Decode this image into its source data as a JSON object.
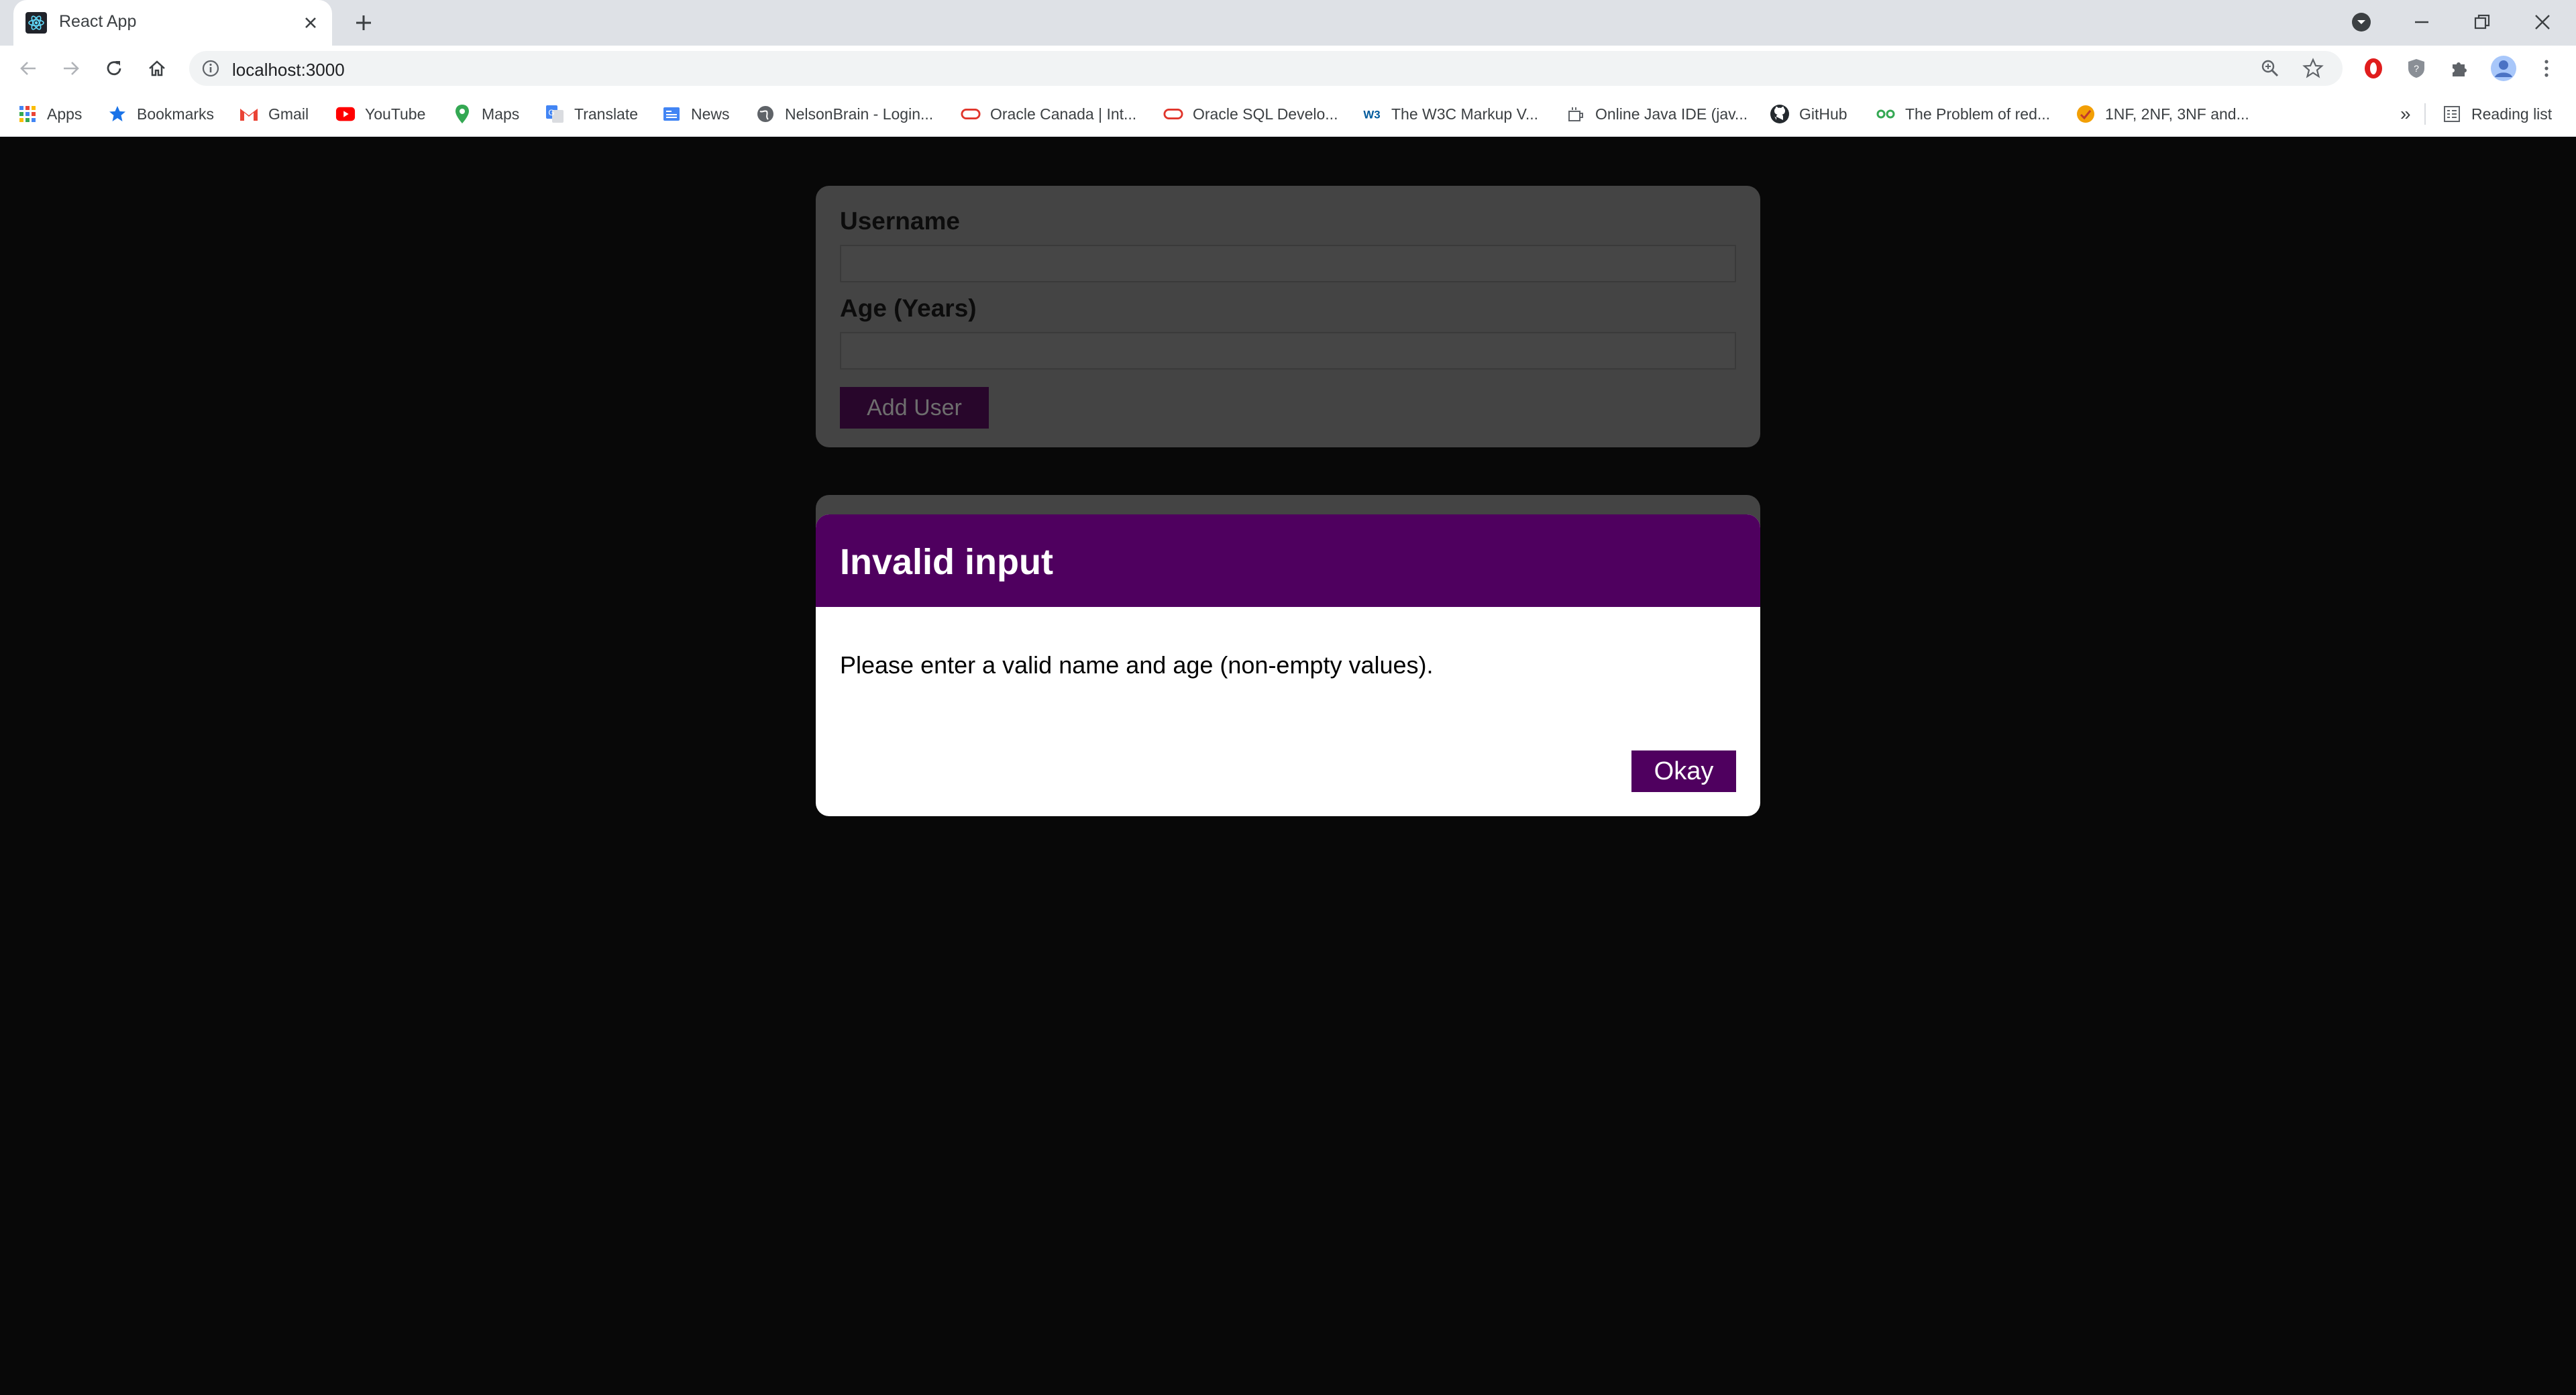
{
  "browser": {
    "tab_title": "React App",
    "url": "localhost:3000",
    "bookmarks": [
      {
        "label": "Apps",
        "icon": "apps-grid-icon"
      },
      {
        "label": "Bookmarks",
        "icon": "star-icon"
      },
      {
        "label": "Gmail",
        "icon": "gmail-icon"
      },
      {
        "label": "YouTube",
        "icon": "youtube-icon"
      },
      {
        "label": "Maps",
        "icon": "maps-pin-icon"
      },
      {
        "label": "Translate",
        "icon": "translate-icon"
      },
      {
        "label": "News",
        "icon": "news-icon"
      },
      {
        "label": "NelsonBrain - Login...",
        "icon": "globe-icon"
      },
      {
        "label": "Oracle Canada | Int...",
        "icon": "oracle-icon"
      },
      {
        "label": "Oracle SQL Develo...",
        "icon": "oracle-icon"
      },
      {
        "label": "The W3C Markup V...",
        "icon": "w3c-icon"
      },
      {
        "label": "Online Java IDE (jav...",
        "icon": "java-icon"
      },
      {
        "label": "GitHub",
        "icon": "github-icon"
      },
      {
        "label": "The Problem of red...",
        "icon": "link-icon"
      },
      {
        "label": "1NF, 2NF, 3NF and...",
        "icon": "site-icon"
      }
    ],
    "overflow_label": "»",
    "reading_list_label": "Reading list"
  },
  "form": {
    "username_label": "Username",
    "username_value": "",
    "age_label": "Age (Years)",
    "age_value": "",
    "submit_label": "Add User"
  },
  "modal": {
    "title": "Invalid input",
    "message": "Please enter a valid name and age (non-empty values).",
    "okay_label": "Okay"
  },
  "colors": {
    "accent": "#4f005f",
    "backdrop": "#080808"
  }
}
